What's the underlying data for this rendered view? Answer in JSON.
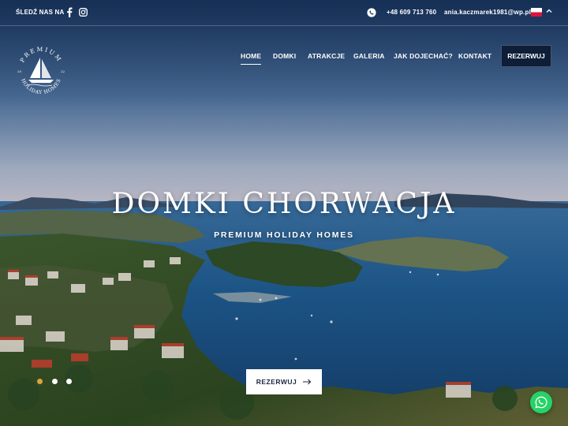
{
  "topbar": {
    "follow_label": "ŚLEDŹ NAS NA",
    "social_icons": [
      "facebook-icon",
      "instagram-icon"
    ],
    "whatsapp_icon": "whatsapp-icon",
    "phone": "+48 609 713 760",
    "email": "ania.kaczmarek1981@wp.pl",
    "language_flag": "poland-flag",
    "language_chevron": "chevron-up-icon"
  },
  "logo": {
    "arc_top": "PREMIUM",
    "arc_bottom": "HOLIDAY HOMES",
    "year_left": "20",
    "year_right": "22"
  },
  "nav": {
    "items": [
      {
        "label": "HOME",
        "active": true
      },
      {
        "label": "DOMKI",
        "active": false
      },
      {
        "label": "ATRAKCJE",
        "active": false
      },
      {
        "label": "GALERIA",
        "active": false
      },
      {
        "label": "JAK DOJECHAĆ?",
        "active": false
      },
      {
        "label": "KONTAKT",
        "active": false
      }
    ],
    "cta_label": "REZERWUJ"
  },
  "hero": {
    "title": "DOMKI CHORWACJA",
    "subtitle": "PREMIUM HOLIDAY HOMES",
    "cta_label": "REZERWUJ",
    "cta_icon": "arrow-right-icon",
    "slides_total": 3,
    "slide_active": 1
  },
  "floating": {
    "whatsapp_icon": "whatsapp-icon"
  },
  "colors": {
    "sky_top": "#1f3f6e",
    "sky_horizon": "#c9c5cd",
    "sea": "#1f5e93",
    "nav_cta_bg": "#0e1e38",
    "active_dot": "#d8a53a",
    "whatsapp_green": "#25d366"
  }
}
